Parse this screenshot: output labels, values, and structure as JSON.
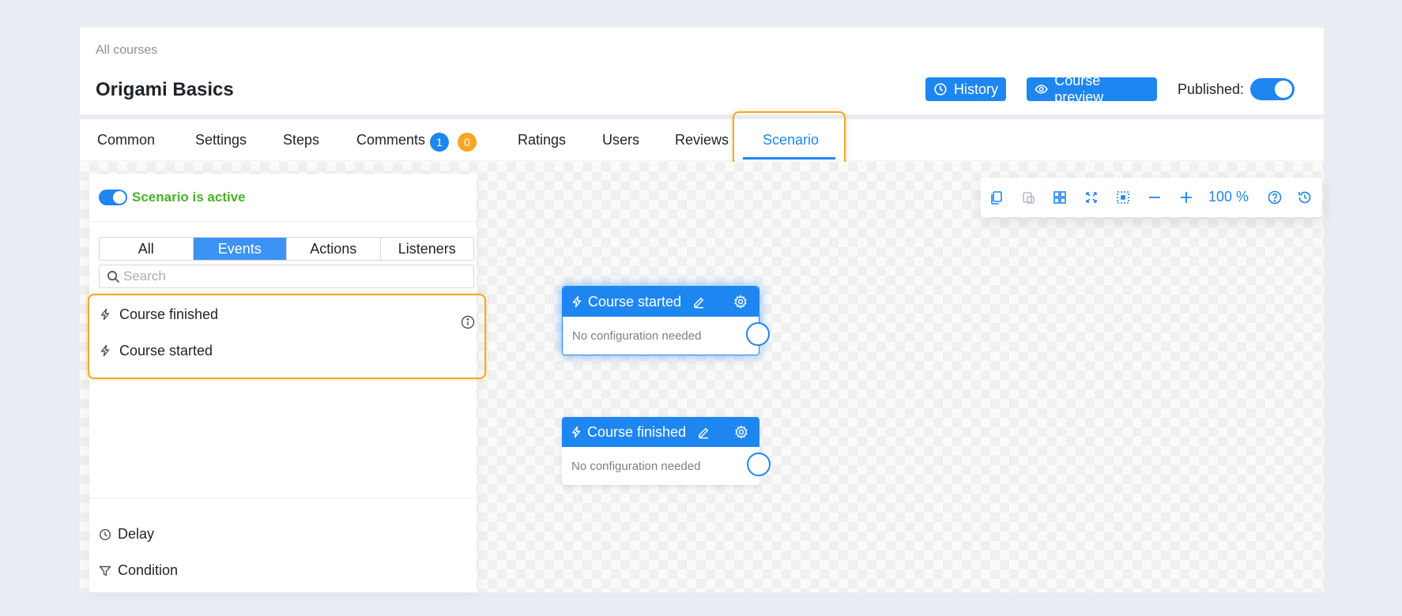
{
  "header": {
    "breadcrumb": "All courses",
    "title": "Origami Basics",
    "history_label": "History",
    "preview_label": "Course preview",
    "published_label": "Published:",
    "published_on": true
  },
  "tabs": [
    {
      "label": "Common"
    },
    {
      "label": "Settings"
    },
    {
      "label": "Steps"
    },
    {
      "label": "Comments"
    },
    {
      "label": "Ratings"
    },
    {
      "label": "Users"
    },
    {
      "label": "Reviews"
    },
    {
      "label": "Scenario",
      "active": true
    }
  ],
  "comment_badges": {
    "blue": "1",
    "orange": "0"
  },
  "sidebar": {
    "active_label": "Scenario is active",
    "filters": [
      "All",
      "Events",
      "Actions",
      "Listeners"
    ],
    "active_filter": "Events",
    "search_placeholder": "Search",
    "events": [
      "Course finished",
      "Course started"
    ],
    "tools": [
      "Delay",
      "Condition"
    ]
  },
  "toolbar": {
    "zoom": "100 %",
    "icons": [
      "copy-icon",
      "paste-icon",
      "grid-icon",
      "fit-screen-icon",
      "select-area-icon",
      "zoom-out-icon",
      "zoom-in-icon",
      "help-icon",
      "history-icon"
    ]
  },
  "nodes": [
    {
      "title": "Course started",
      "body": "No configuration needed",
      "selected": true
    },
    {
      "title": "Course finished",
      "body": "No configuration needed",
      "selected": false
    }
  ],
  "colors": {
    "accent": "#1e86f0",
    "active_green": "#4caf2a",
    "highlight": "#f0a92a",
    "badge_orange": "#f5a623"
  }
}
